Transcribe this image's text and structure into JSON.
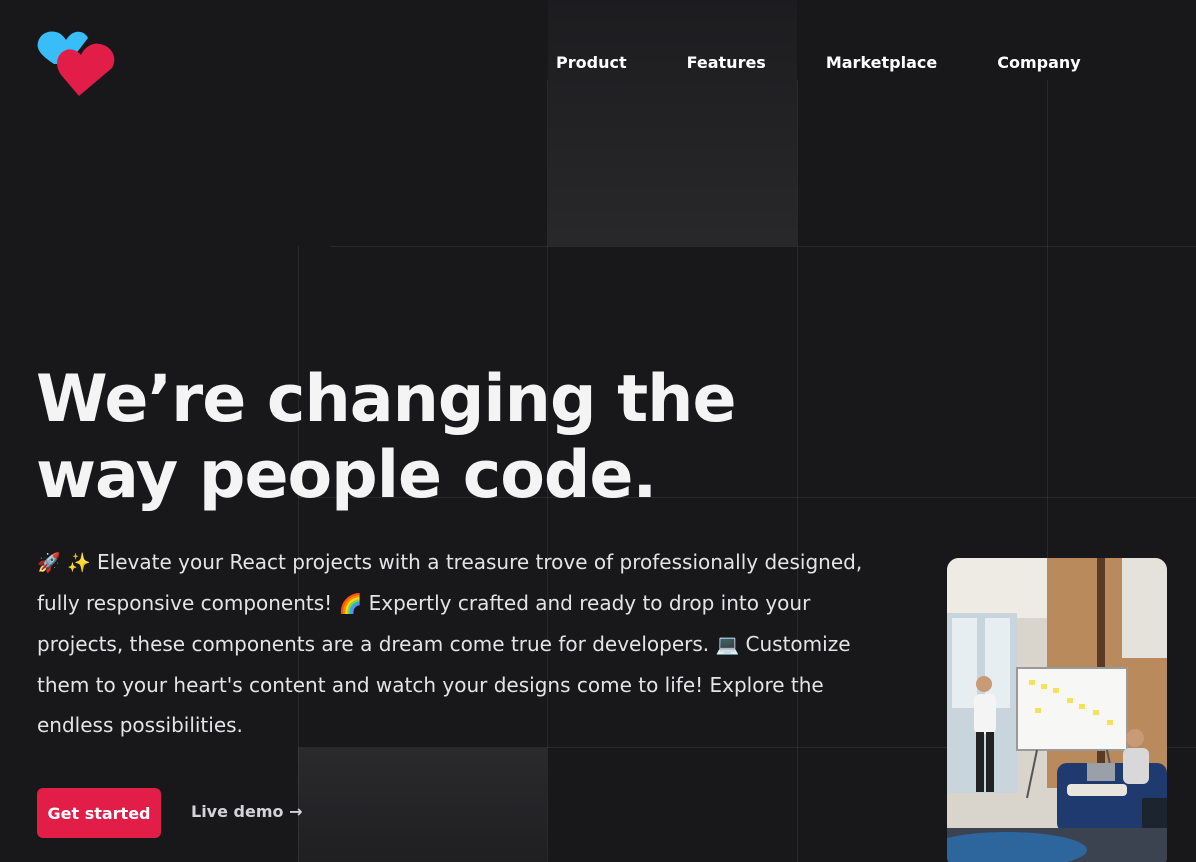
{
  "brand": {
    "logo_icon": "heart-logo-icon",
    "colors": {
      "blue": "#38bdf8",
      "red": "#e11d48"
    }
  },
  "nav": {
    "items": [
      {
        "label": "Product"
      },
      {
        "label": "Features"
      },
      {
        "label": "Marketplace"
      },
      {
        "label": "Company"
      }
    ]
  },
  "hero": {
    "headline": "We’re changing the way people code.",
    "lead": {
      "emoji_rocket": "🚀",
      "emoji_sparkles": "✨",
      "part1": " Elevate your React projects with a treasure trove of professionally designed, fully responsive components! ",
      "emoji_rainbow": "🌈",
      "part2": " Expertly crafted and ready to drop into your projects, these components are a dream come true for developers. ",
      "emoji_laptop": "💻",
      "part3": " Customize them to your heart's content and watch your designs come to life! Explore the endless possibilities."
    },
    "cta_primary": "Get started",
    "cta_secondary": "Live demo →",
    "accent_color": "#e11d48"
  },
  "photo": {
    "icon": "team-meeting-photo"
  }
}
